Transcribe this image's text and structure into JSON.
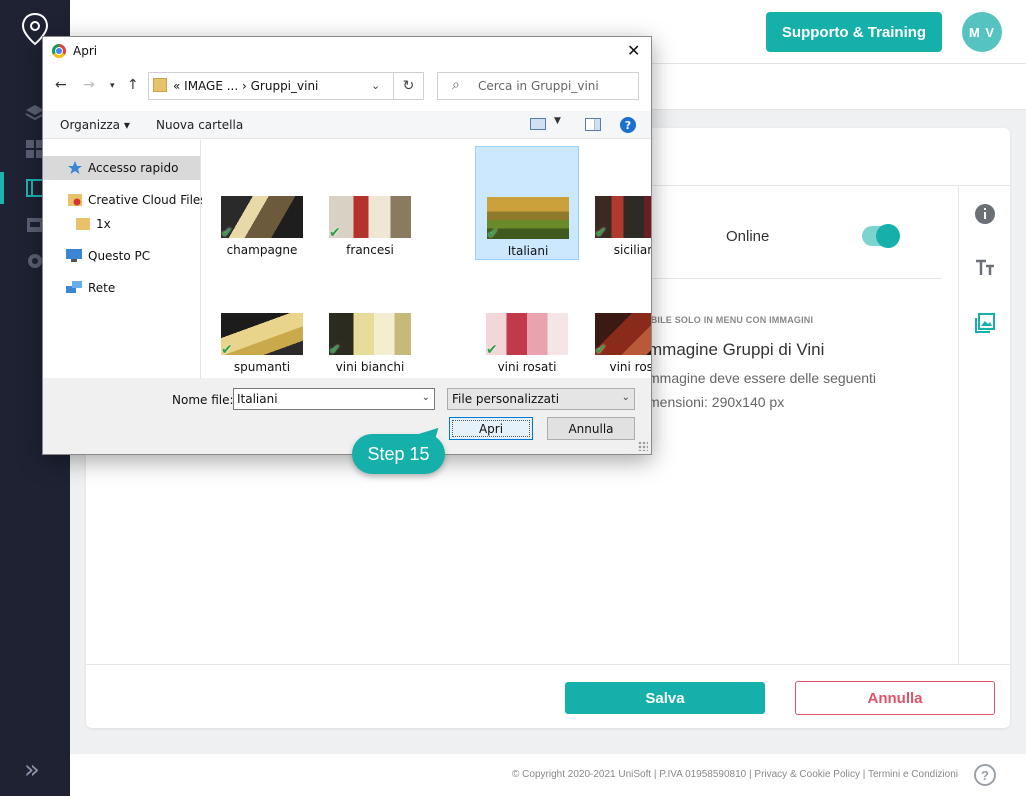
{
  "header": {
    "support_label": "Supporto & Training",
    "avatar_initials": "M V"
  },
  "content": {
    "online_label": "Online",
    "online_toggle_on": true,
    "image_note": "IBILE SOLO IN MENU CON IMMAGINI",
    "image_title": "mmagine Gruppi di Vini",
    "image_desc_line1": "mmagine deve essere delle seguenti",
    "image_desc_line2": "mensioni: 290x140 px",
    "save_label": "Salva",
    "cancel_label": "Annulla"
  },
  "footer": {
    "text": "© Copyright 2020-2021 UniSoft | P.IVA 01958590810 | Privacy & Cookie Policy | Termini e Condizioni",
    "help": "?"
  },
  "dialog": {
    "title": "Apri",
    "close": "✕",
    "address_crumbs": "«  IMAGE ...  ›  Gruppi_vini",
    "search_placeholder": "Cerca in Gruppi_vini",
    "toolbar": {
      "organize": "Organizza ▾",
      "new_folder": "Nuova cartella"
    },
    "nav_items": [
      "Accesso rapido",
      "Creative Cloud Files",
      "1x",
      "Questo PC",
      "Rete"
    ],
    "files": [
      "champagne",
      "francesi",
      "Italiani",
      "siciliani",
      "spumanti",
      "vini bianchi",
      "vini rosati",
      "vini rossi"
    ],
    "selected_file": "Italiani",
    "filename_label": "Nome file:",
    "filename_value": "Italiani",
    "filetype_value": "File personalizzati",
    "open_label": "Apri",
    "cancel_label": "Annulla"
  },
  "callout": {
    "label": "Step 15"
  },
  "colors": {
    "accent": "#16b0ab",
    "danger": "#e0546b",
    "sidebar": "#1e2233"
  }
}
